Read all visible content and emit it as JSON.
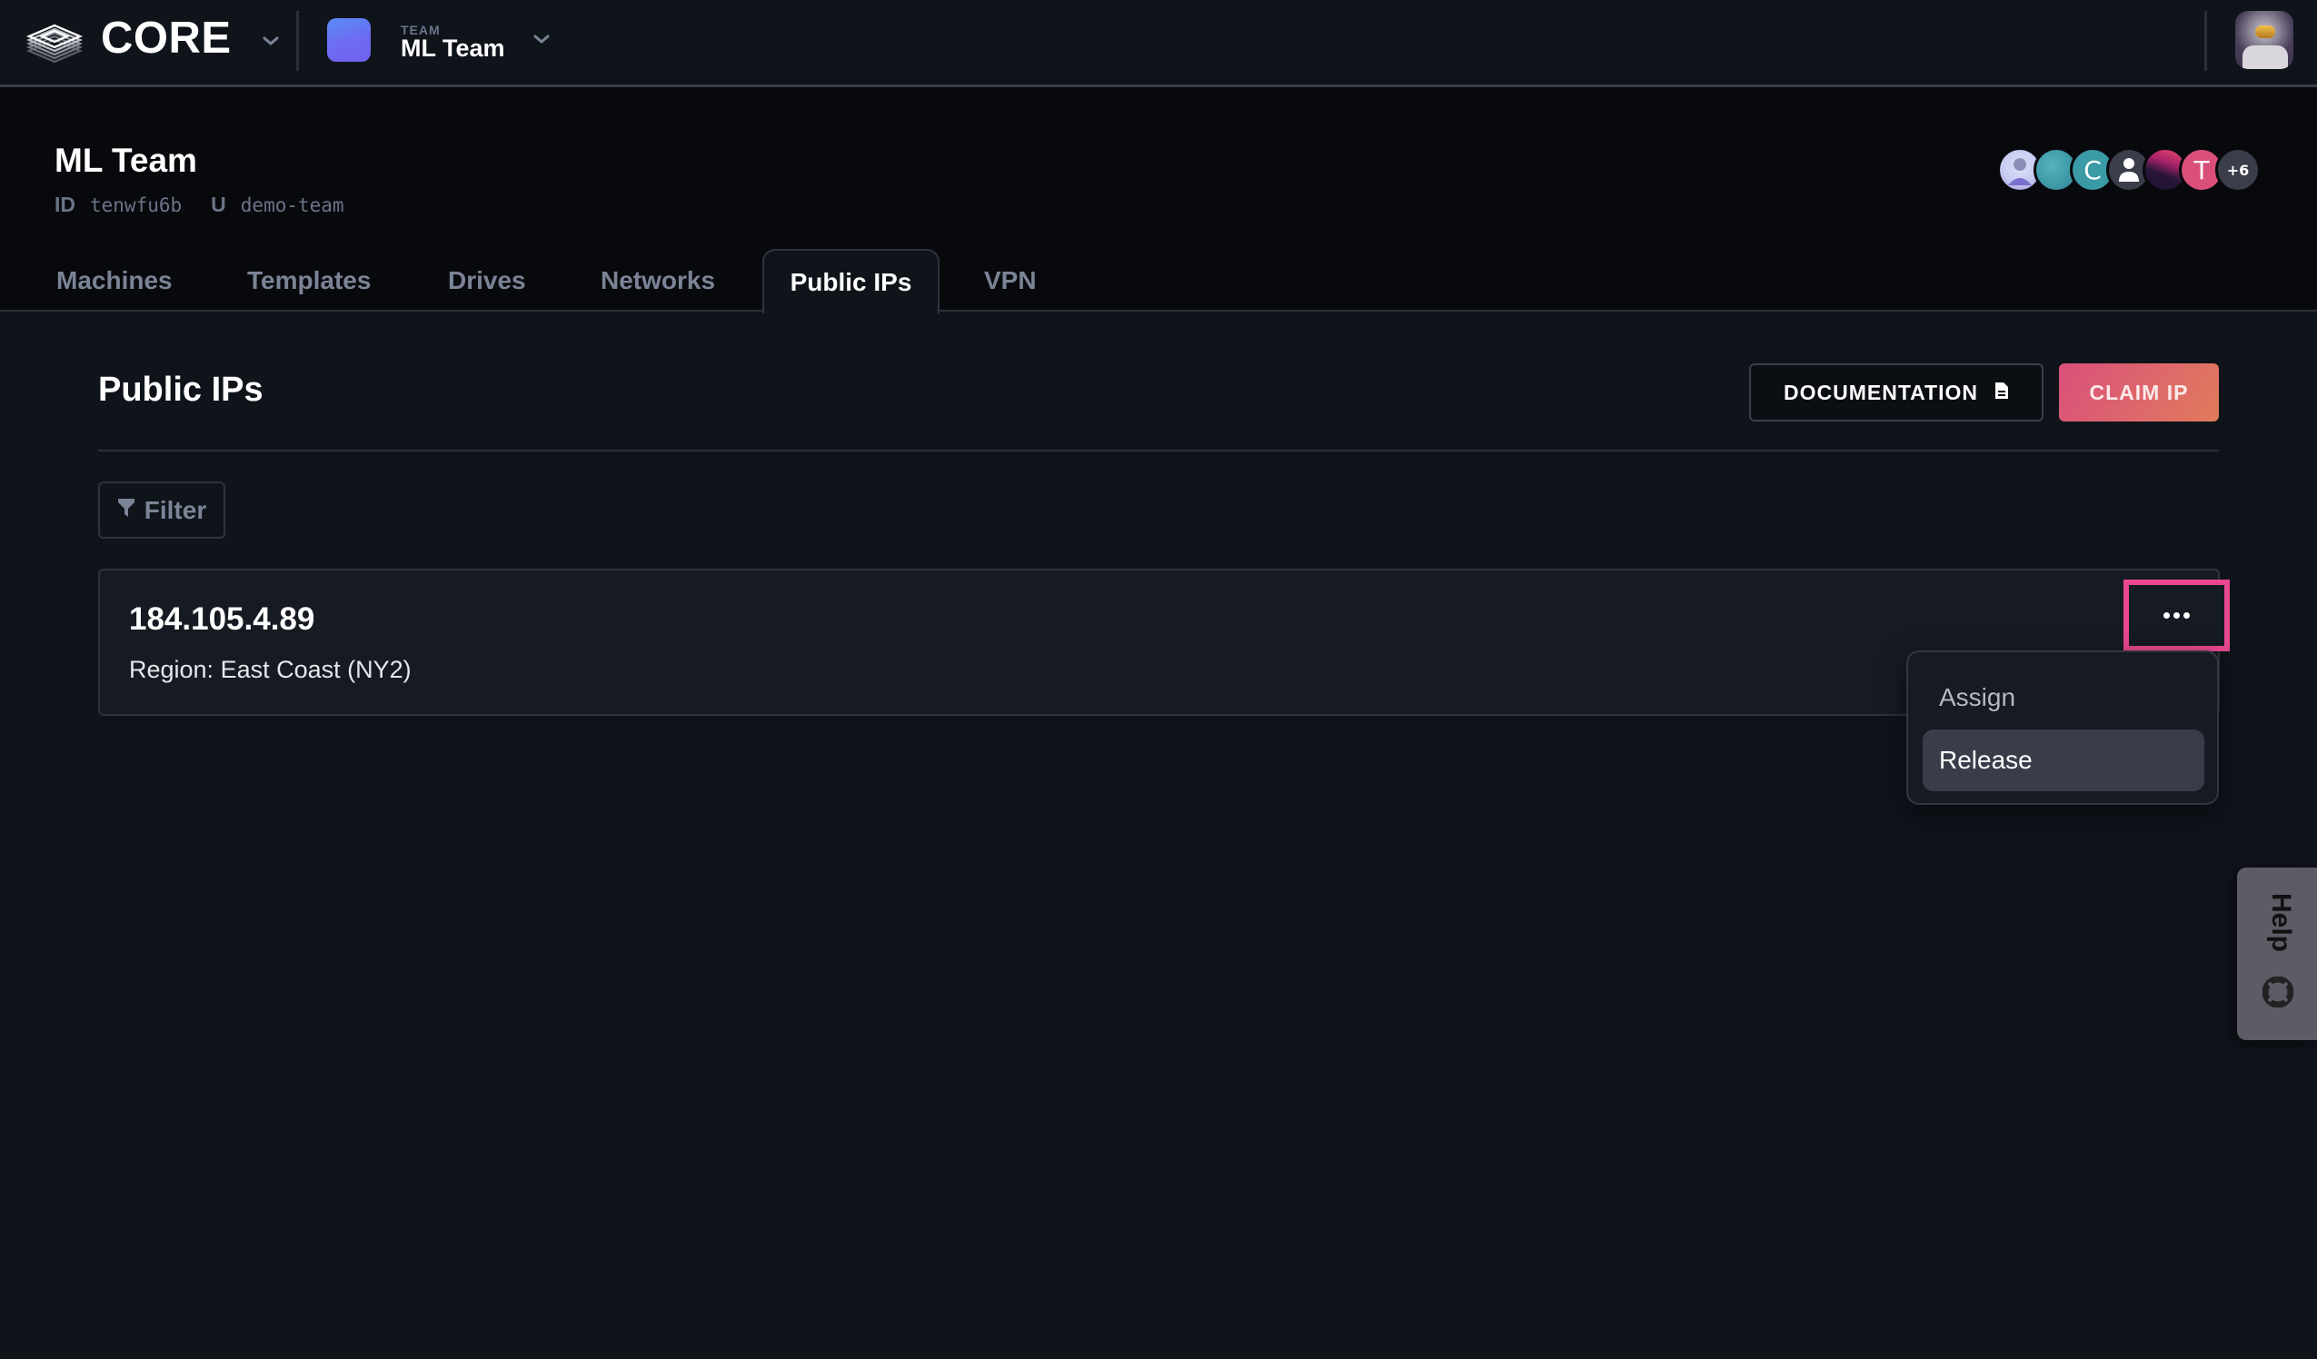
{
  "topbar": {
    "brand": "CORE",
    "team_label": "TEAM",
    "team_name": "ML Team",
    "icons": {
      "logo": "stacked-layers-icon",
      "brand_menu": "chevron-down-icon",
      "team_menu": "chevron-down-icon",
      "user_avatar": "astronaut-avatar"
    }
  },
  "team_header": {
    "title": "ML Team",
    "id_label": "ID",
    "id_value": "tenwfu6b",
    "u_label": "U",
    "u_value": "demo-team",
    "members": [
      {
        "type": "photo",
        "color": "#c9cdf5"
      },
      {
        "type": "photo",
        "color": "#3c9aa8"
      },
      {
        "type": "initial",
        "initial": "C",
        "color": "#3a9aa6"
      },
      {
        "type": "icon",
        "icon": "person-icon",
        "color": "#3a3d4a"
      },
      {
        "type": "photo",
        "color": "#5a1c4a"
      },
      {
        "type": "initial",
        "initial": "T",
        "color": "#d94f7a"
      },
      {
        "type": "more",
        "label": "+6",
        "color": "#3a3d4a"
      }
    ]
  },
  "tabs": [
    {
      "label": "Machines",
      "active": false
    },
    {
      "label": "Templates",
      "active": false
    },
    {
      "label": "Drives",
      "active": false
    },
    {
      "label": "Networks",
      "active": false
    },
    {
      "label": "Public IPs",
      "active": true
    },
    {
      "label": "VPN",
      "active": false
    }
  ],
  "main": {
    "title": "Public IPs",
    "documentation_label": "DOCUMENTATION",
    "documentation_icon": "document-icon",
    "claim_label": "CLAIM IP",
    "filter_label": "Filter",
    "filter_icon": "funnel-icon",
    "ips": [
      {
        "address": "184.105.4.89",
        "region": "Region: East Coast (NY2)"
      }
    ],
    "menu": {
      "items": [
        {
          "label": "Assign",
          "highlighted": false
        },
        {
          "label": "Release",
          "highlighted": true
        }
      ]
    }
  },
  "help": {
    "label": "Help",
    "icon": "lifebuoy-icon"
  },
  "colors": {
    "accent_pink": "#e8488f",
    "claim_gradient_start": "#d9507a",
    "claim_gradient_end": "#e07b5a",
    "background": "#0f131a",
    "header_background": "#08090d"
  }
}
